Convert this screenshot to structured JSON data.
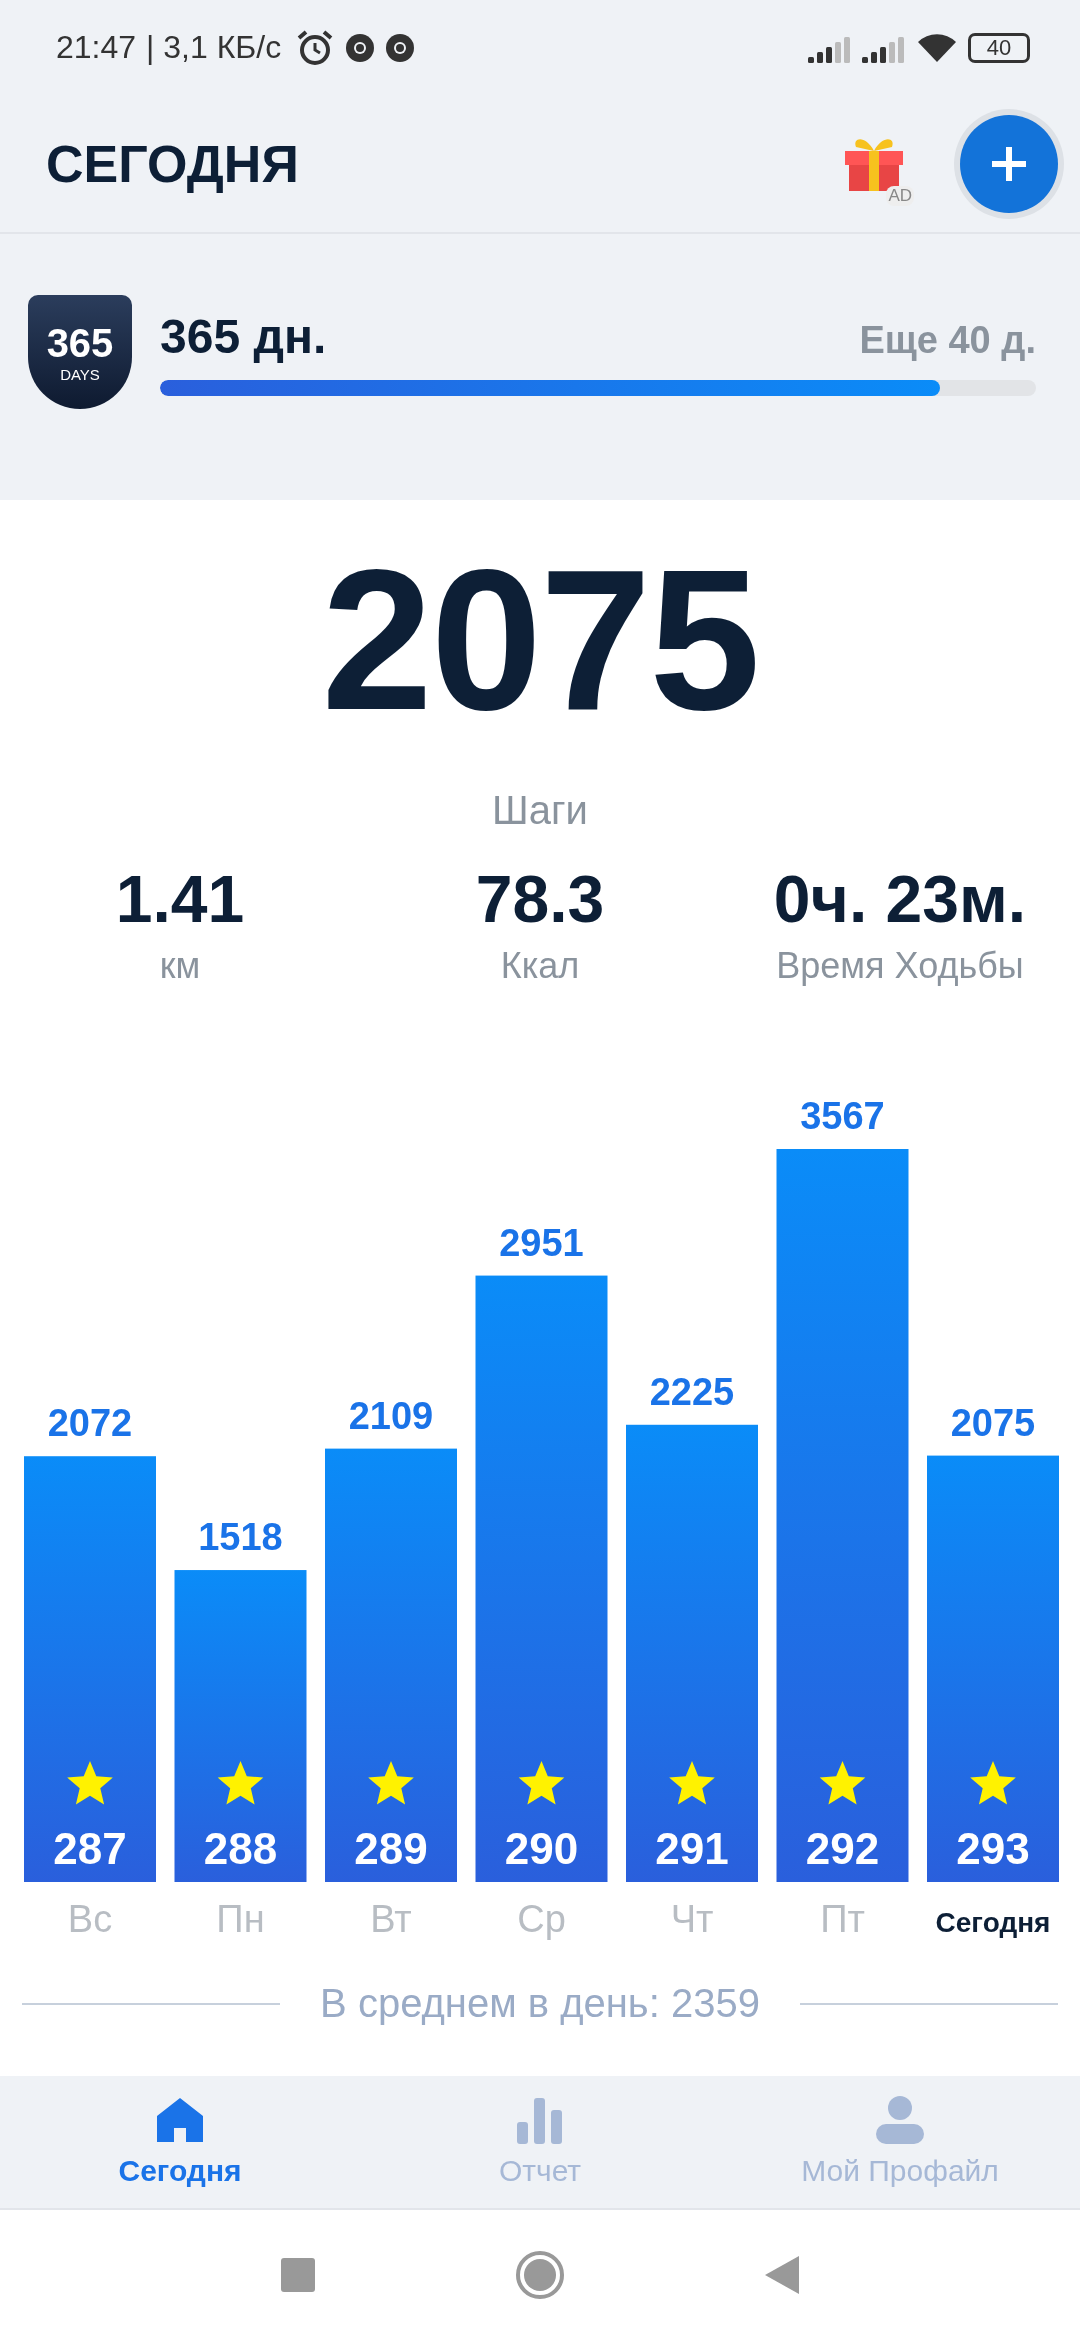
{
  "status_bar": {
    "time": "21:47",
    "speed": "| 3,1 КБ/с",
    "battery": "40"
  },
  "header": {
    "title": "СЕГОДНЯ",
    "ad_label": "AD"
  },
  "goal": {
    "badge_number": "365",
    "badge_caption": "DAYS",
    "title": "365 дн.",
    "remaining": "Еще 40 д.",
    "level": 0.89
  },
  "summary": {
    "steps": "2075",
    "steps_label": "Шаги",
    "stats": [
      {
        "value": "1.41",
        "label": "км"
      },
      {
        "value": "78.3",
        "label": "Ккал"
      },
      {
        "value": "0ч. 23м.",
        "label": "Время Ходьбы"
      }
    ]
  },
  "week_chart": {
    "chart_data": {
      "type": "bar",
      "categories": [
        "Вс",
        "Пн",
        "Вт",
        "Ср",
        "Чт",
        "Пт",
        "Сегодня"
      ],
      "values": [
        2072,
        1518,
        2109,
        2951,
        2225,
        3567,
        2075
      ],
      "data_labels": true
    },
    "days": [
      {
        "badge": "287",
        "selected": false
      },
      {
        "badge": "288",
        "selected": false
      },
      {
        "badge": "289",
        "selected": false
      },
      {
        "badge": "290",
        "selected": false
      },
      {
        "badge": "291",
        "selected": false
      },
      {
        "badge": "292",
        "selected": false
      },
      {
        "badge": "293",
        "selected": true
      }
    ],
    "average": "В среднем в день: 2359"
  },
  "bottom_nav": [
    {
      "label": "Сегодня",
      "kind": "home",
      "selected": true
    },
    {
      "label": "Отчет",
      "kind": "report",
      "selected": false
    },
    {
      "label": "Мой Профайл",
      "kind": "profile",
      "selected": false
    }
  ]
}
